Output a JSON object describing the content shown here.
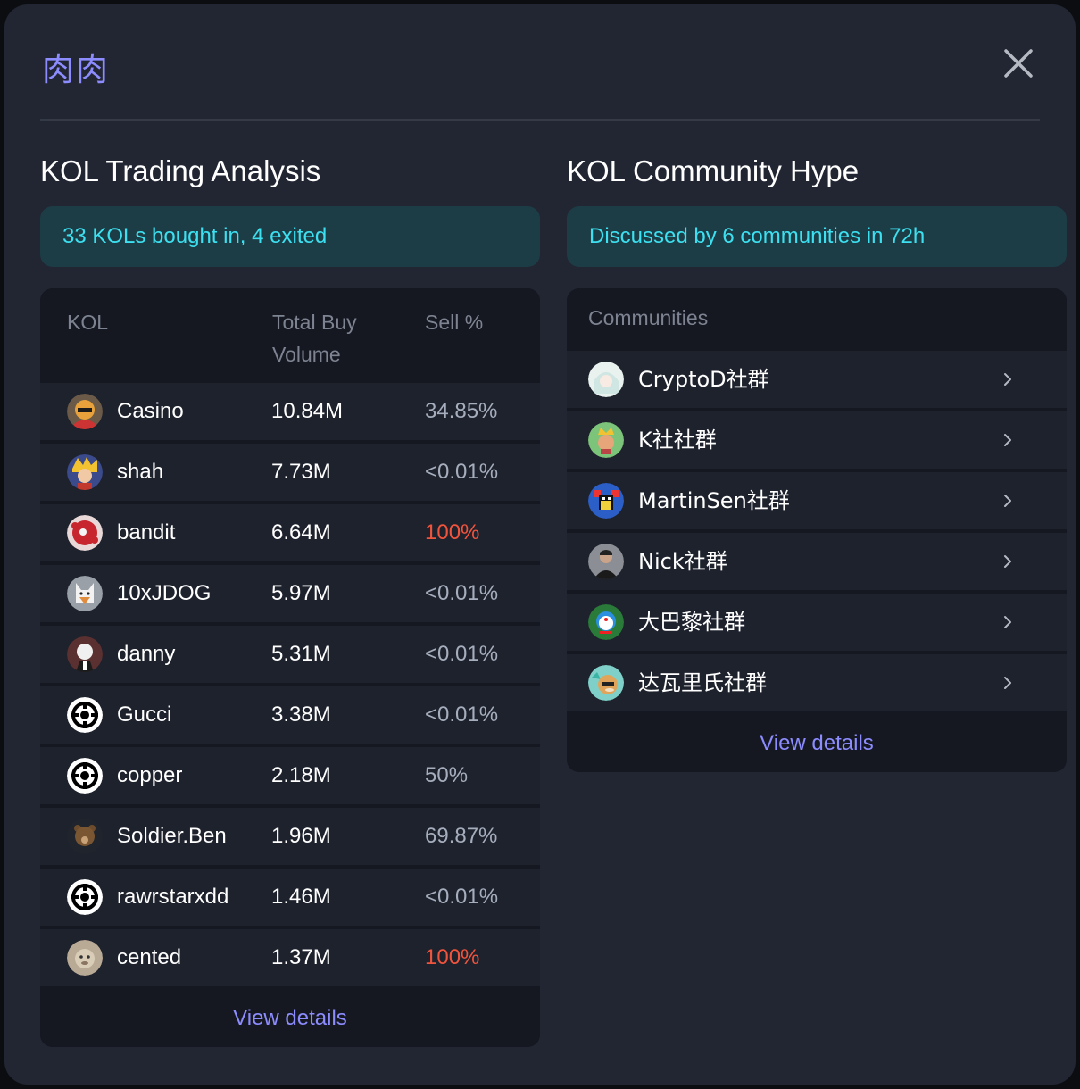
{
  "modal": {
    "title": "肉肉"
  },
  "left": {
    "section_title": "KOL Trading Analysis",
    "banner": "33 KOLs bought in, 4 exited",
    "headers": {
      "kol": "KOL",
      "volume": "Total Buy Volume",
      "sell": "Sell %"
    },
    "rows": [
      {
        "name": "Casino",
        "volume": "10.84M",
        "sell": "34.85%",
        "avatar": "cartoon-bird-avatar"
      },
      {
        "name": "shah",
        "volume": "7.73M",
        "sell": "<0.01%",
        "avatar": "anime-character-avatar"
      },
      {
        "name": "bandit",
        "volume": "6.64M",
        "sell": "100%",
        "avatar": "red-splatter-avatar"
      },
      {
        "name": "10xJDOG",
        "volume": "5.97M",
        "sell": "<0.01%",
        "avatar": "dog-avatar"
      },
      {
        "name": "danny",
        "volume": "5.31M",
        "sell": "<0.01%",
        "avatar": "cat-suit-avatar"
      },
      {
        "name": "Gucci",
        "volume": "3.38M",
        "sell": "<0.01%",
        "avatar": "default-logo-avatar"
      },
      {
        "name": "copper",
        "volume": "2.18M",
        "sell": "50%",
        "avatar": "default-logo-avatar"
      },
      {
        "name": "Soldier.Ben",
        "volume": "1.96M",
        "sell": "69.87%",
        "avatar": "bear-avatar"
      },
      {
        "name": "rawrstarxdd",
        "volume": "1.46M",
        "sell": "<0.01%",
        "avatar": "default-logo-avatar"
      },
      {
        "name": "cented",
        "volume": "1.37M",
        "sell": "100%",
        "avatar": "monkey-avatar"
      }
    ],
    "view_details": "View details"
  },
  "right": {
    "section_title": "KOL Community Hype",
    "banner": "Discussed by 6 communities in 72h",
    "header": "Communities",
    "rows": [
      {
        "name": "CryptoD社群",
        "avatar": "anime-girl-avatar"
      },
      {
        "name": "K社社群",
        "avatar": "cartoon-king-avatar"
      },
      {
        "name": "MartinSen社群",
        "avatar": "pixel-art-avatar"
      },
      {
        "name": "Nick社群",
        "avatar": "person-photo-avatar"
      },
      {
        "name": "大巴黎社群",
        "avatar": "doraemon-avatar"
      },
      {
        "name": "达瓦里氏社群",
        "avatar": "doge-avatar"
      }
    ],
    "view_details": "View details"
  },
  "colors": {
    "accent": "#8c8cff",
    "banner_text": "#3ce0f0",
    "sell_red": "#f0543d",
    "modal_bg": "#222633"
  }
}
